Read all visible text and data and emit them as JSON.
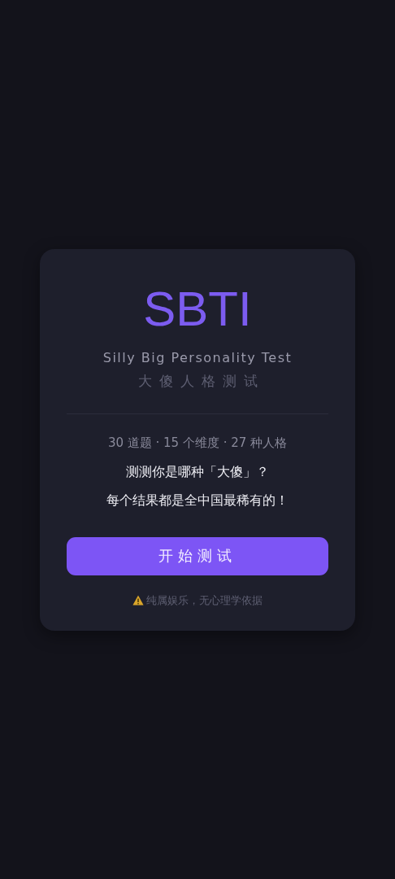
{
  "card": {
    "title": "SBTI",
    "subtitle": "Silly Big Personality Test",
    "subtitle_cn": "大傻人格测试",
    "stats": "30 道题 · 15 个维度 · 27 种人格",
    "tagline": "测测你是哪种「大傻」？",
    "tagline2": "每个结果都是全中国最稀有的！",
    "start_button": "开始测试",
    "disclaimer": "纯属娱乐，无心理学依据"
  }
}
